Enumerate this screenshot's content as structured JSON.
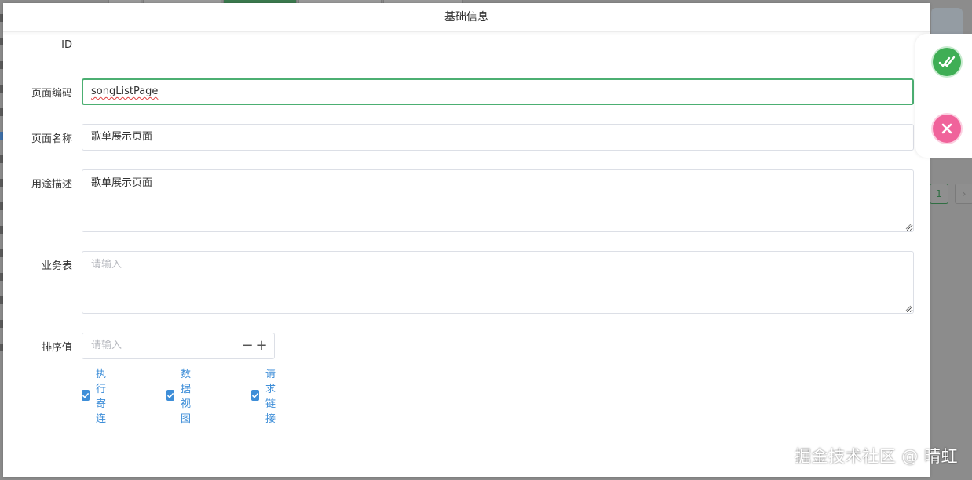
{
  "modal": {
    "title": "基础信息"
  },
  "form": {
    "id_label": "ID",
    "id_value": "",
    "code_label": "页面编码",
    "code_value": "songListPage",
    "name_label": "页面名称",
    "name_value": "歌单展示页面",
    "desc_label": "用途描述",
    "desc_value": "歌单展示页面",
    "table_label": "业务表",
    "table_placeholder": "请输入",
    "order_label": "排序值",
    "order_placeholder": "请输入",
    "stepper_minus": "−",
    "stepper_plus": "+"
  },
  "checkboxes": [
    {
      "label": "执行寄连",
      "checked": true
    },
    {
      "label": "数据视图",
      "checked": true
    },
    {
      "label": "请求链接",
      "checked": true
    }
  ],
  "background": {
    "pager_current": "1",
    "pager_next": "›"
  },
  "actions": {
    "confirm_icon": "double-check-icon",
    "cancel_icon": "close-icon"
  },
  "colors": {
    "focus_border": "#4caf72",
    "checkbox": "#3e8ed8",
    "confirm": "#3fae55",
    "cancel": "#f0639b"
  },
  "watermark": "掘金技术社区 @ 晴虹"
}
